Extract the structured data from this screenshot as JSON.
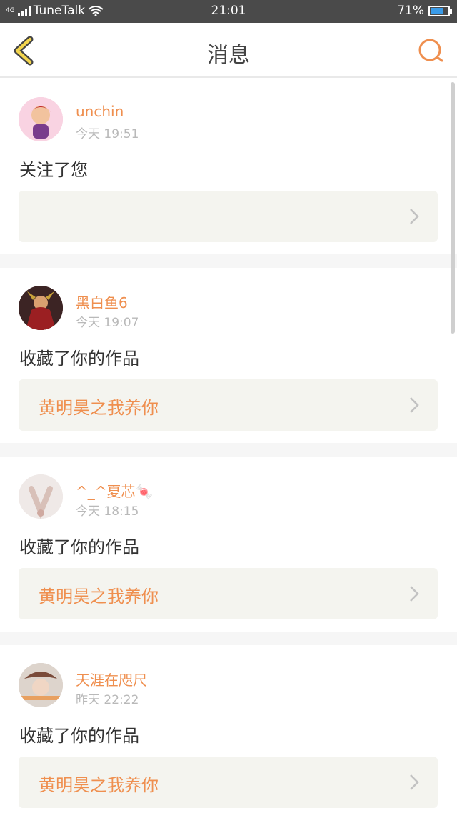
{
  "status_bar": {
    "network": "4G",
    "carrier": "TuneTalk",
    "time": "21:01",
    "battery": "71%",
    "battery_level": 0.71,
    "battery_color": "#3a9be8"
  },
  "header": {
    "title": "消息",
    "back_icon": "chevron-left-icon",
    "search_icon": "search-icon",
    "accent_color": "#ef8f4f"
  },
  "messages": [
    {
      "user": "unchin",
      "time": "今天 19:51",
      "action": "关注了您",
      "work": ""
    },
    {
      "user": "黑白鱼6",
      "time": "今天 19:07",
      "action": "收藏了你的作品",
      "work": "黄明昊之我养你"
    },
    {
      "user": "^_^夏芯🍬",
      "time": "今天 18:15",
      "action": "收藏了你的作品",
      "work": "黄明昊之我养你"
    },
    {
      "user": "天涯在咫尺",
      "time": "昨天 22:22",
      "action": "收藏了你的作品",
      "work": "黄明昊之我养你"
    }
  ]
}
